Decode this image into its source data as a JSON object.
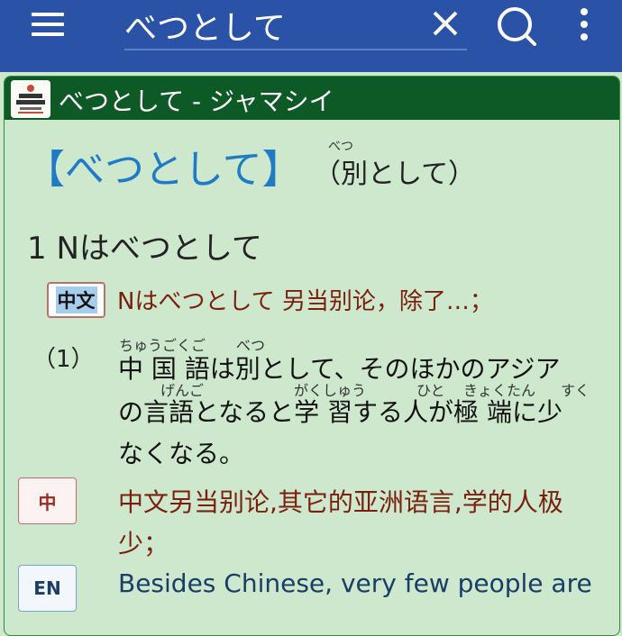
{
  "appbar": {
    "search_value": "べつとして",
    "colors": {
      "bar": "#2a52a6",
      "icons": "#ffffff"
    },
    "icons": [
      "menu-icon",
      "clear-icon",
      "search-icon",
      "more-vert-icon"
    ]
  },
  "card": {
    "title": "べつとして - ジャマシイ",
    "colors": {
      "header": "#0e5a27",
      "body": "#cde8cd"
    }
  },
  "entry": {
    "headword": "【べつとして】",
    "kanji_reading": "べつ",
    "kanji_form": "（別として）",
    "sense_title": "1  Nはべつとして",
    "badge_zhwen": "中文",
    "translation_zh": "Nはべつとして 另当别论，除了…；",
    "example_number": "（1）",
    "example_line1": "中 国 語は別として、そのほかのアジア",
    "example_line2": "の言語となると学  習する人が極  端に少",
    "example_line3": "なくなる。",
    "furigana": {
      "chuugokugo": "ちゅうごくご",
      "betsu": "べつ",
      "gengo": "げんご",
      "gakushuu": "がくしゅう",
      "hito": "ひと",
      "kyokutan": "きょくたん",
      "suku": "すく"
    },
    "badge_zh": "中",
    "example_zh_line1": "中文另当别论,其它的亚洲语言,学的人极",
    "example_zh_line2": "少；",
    "badge_en": "EN",
    "example_en": "Besides Chinese, very few people are"
  }
}
